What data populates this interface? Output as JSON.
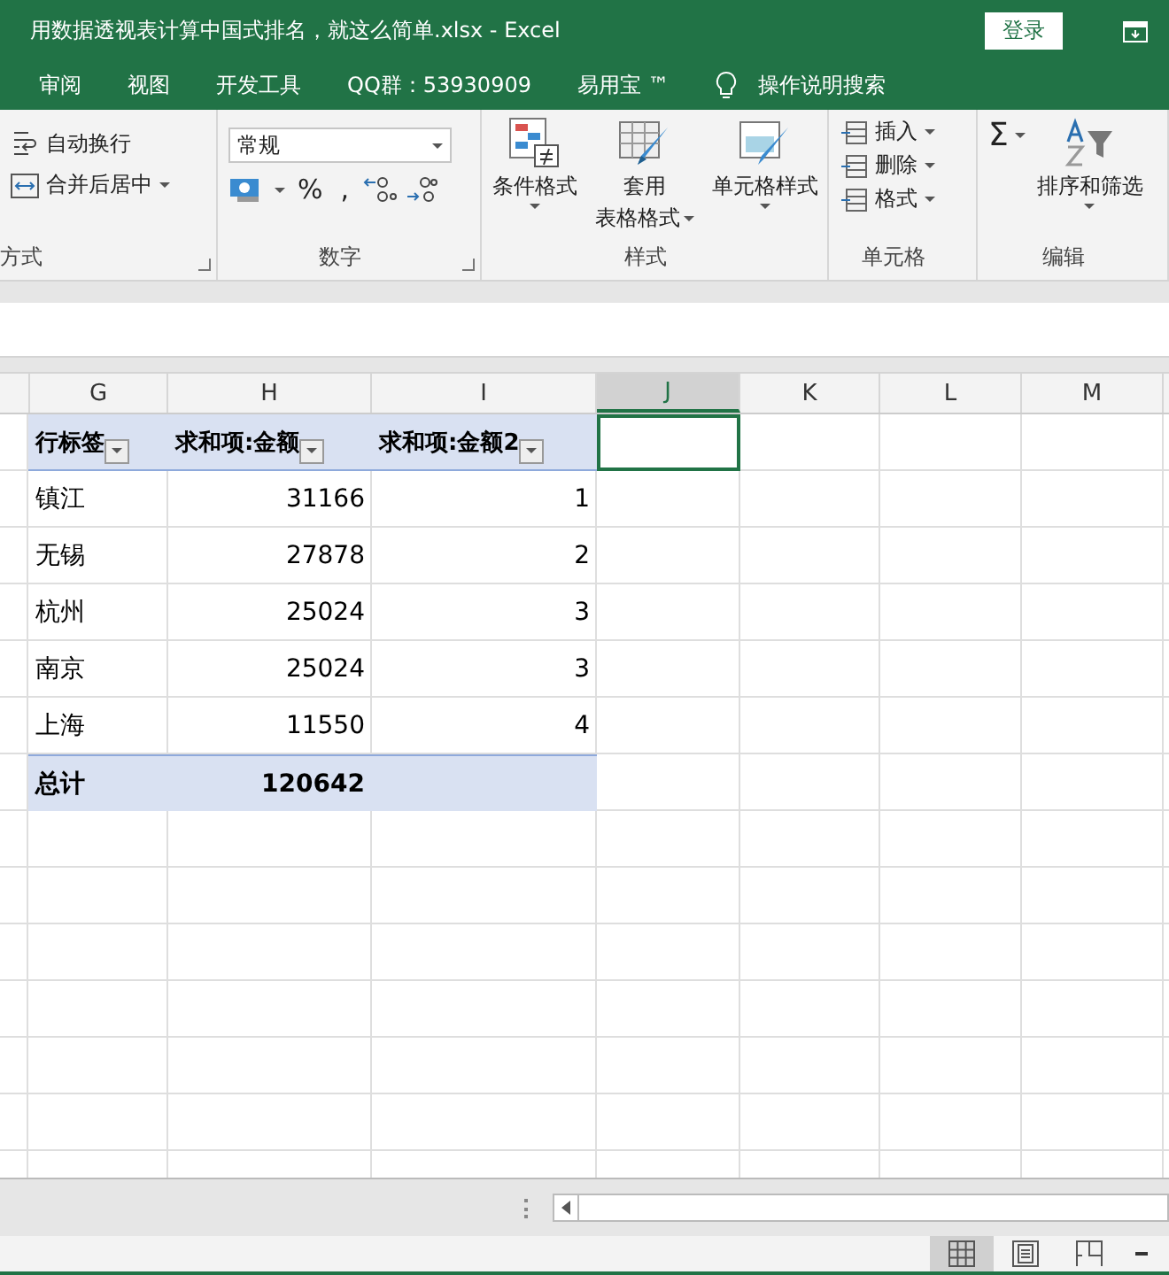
{
  "window": {
    "title": "用数据透视表计算中国式排名，就这么简单.xlsx  -  Excel",
    "login": "登录"
  },
  "tabs": [
    {
      "label": "审阅"
    },
    {
      "label": "视图"
    },
    {
      "label": "开发工具"
    },
    {
      "label": "QQ群：53930909"
    },
    {
      "label": "易用宝 ™"
    }
  ],
  "tell_me": "操作说明搜索",
  "ribbon": {
    "alignment": {
      "label": "方式",
      "wrap": "自动换行",
      "merge": "合并后居中"
    },
    "number": {
      "label": "数字",
      "format": "常规",
      "percent": "%",
      "comma": ","
    },
    "styles": {
      "label": "样式",
      "conditional": "条件格式",
      "table": [
        "套用",
        "表格格式"
      ],
      "cell": "单元格样式"
    },
    "cells": {
      "label": "单元格",
      "items": [
        "插入",
        "删除",
        "格式"
      ]
    },
    "editing": {
      "label": "编辑",
      "sigma": "Σ",
      "sort": "排序和筛选"
    }
  },
  "columns": [
    {
      "label": "G",
      "selected": false
    },
    {
      "label": "H",
      "selected": false
    },
    {
      "label": "I",
      "selected": false
    },
    {
      "label": "J",
      "selected": true
    },
    {
      "label": "K",
      "selected": false
    },
    {
      "label": "L",
      "selected": false
    },
    {
      "label": "M",
      "selected": false
    }
  ],
  "rows": [
    {
      "kind": "header",
      "cells": [
        "行标签",
        "求和项:金额",
        "求和项:金额2"
      ]
    },
    {
      "kind": "data",
      "cells": [
        "镇江",
        "31166",
        "1"
      ]
    },
    {
      "kind": "data",
      "cells": [
        "无锡",
        "27878",
        "2"
      ]
    },
    {
      "kind": "data",
      "cells": [
        "杭州",
        "25024",
        "3"
      ]
    },
    {
      "kind": "data",
      "cells": [
        "南京",
        "25024",
        "3"
      ]
    },
    {
      "kind": "data",
      "cells": [
        "上海",
        "11550",
        "4"
      ]
    },
    {
      "kind": "total",
      "cells": [
        "总计",
        "120642"
      ]
    }
  ],
  "views": [
    {
      "kind": "normal",
      "selected": true
    },
    {
      "kind": "page",
      "selected": false
    },
    {
      "kind": "break",
      "selected": false
    }
  ]
}
